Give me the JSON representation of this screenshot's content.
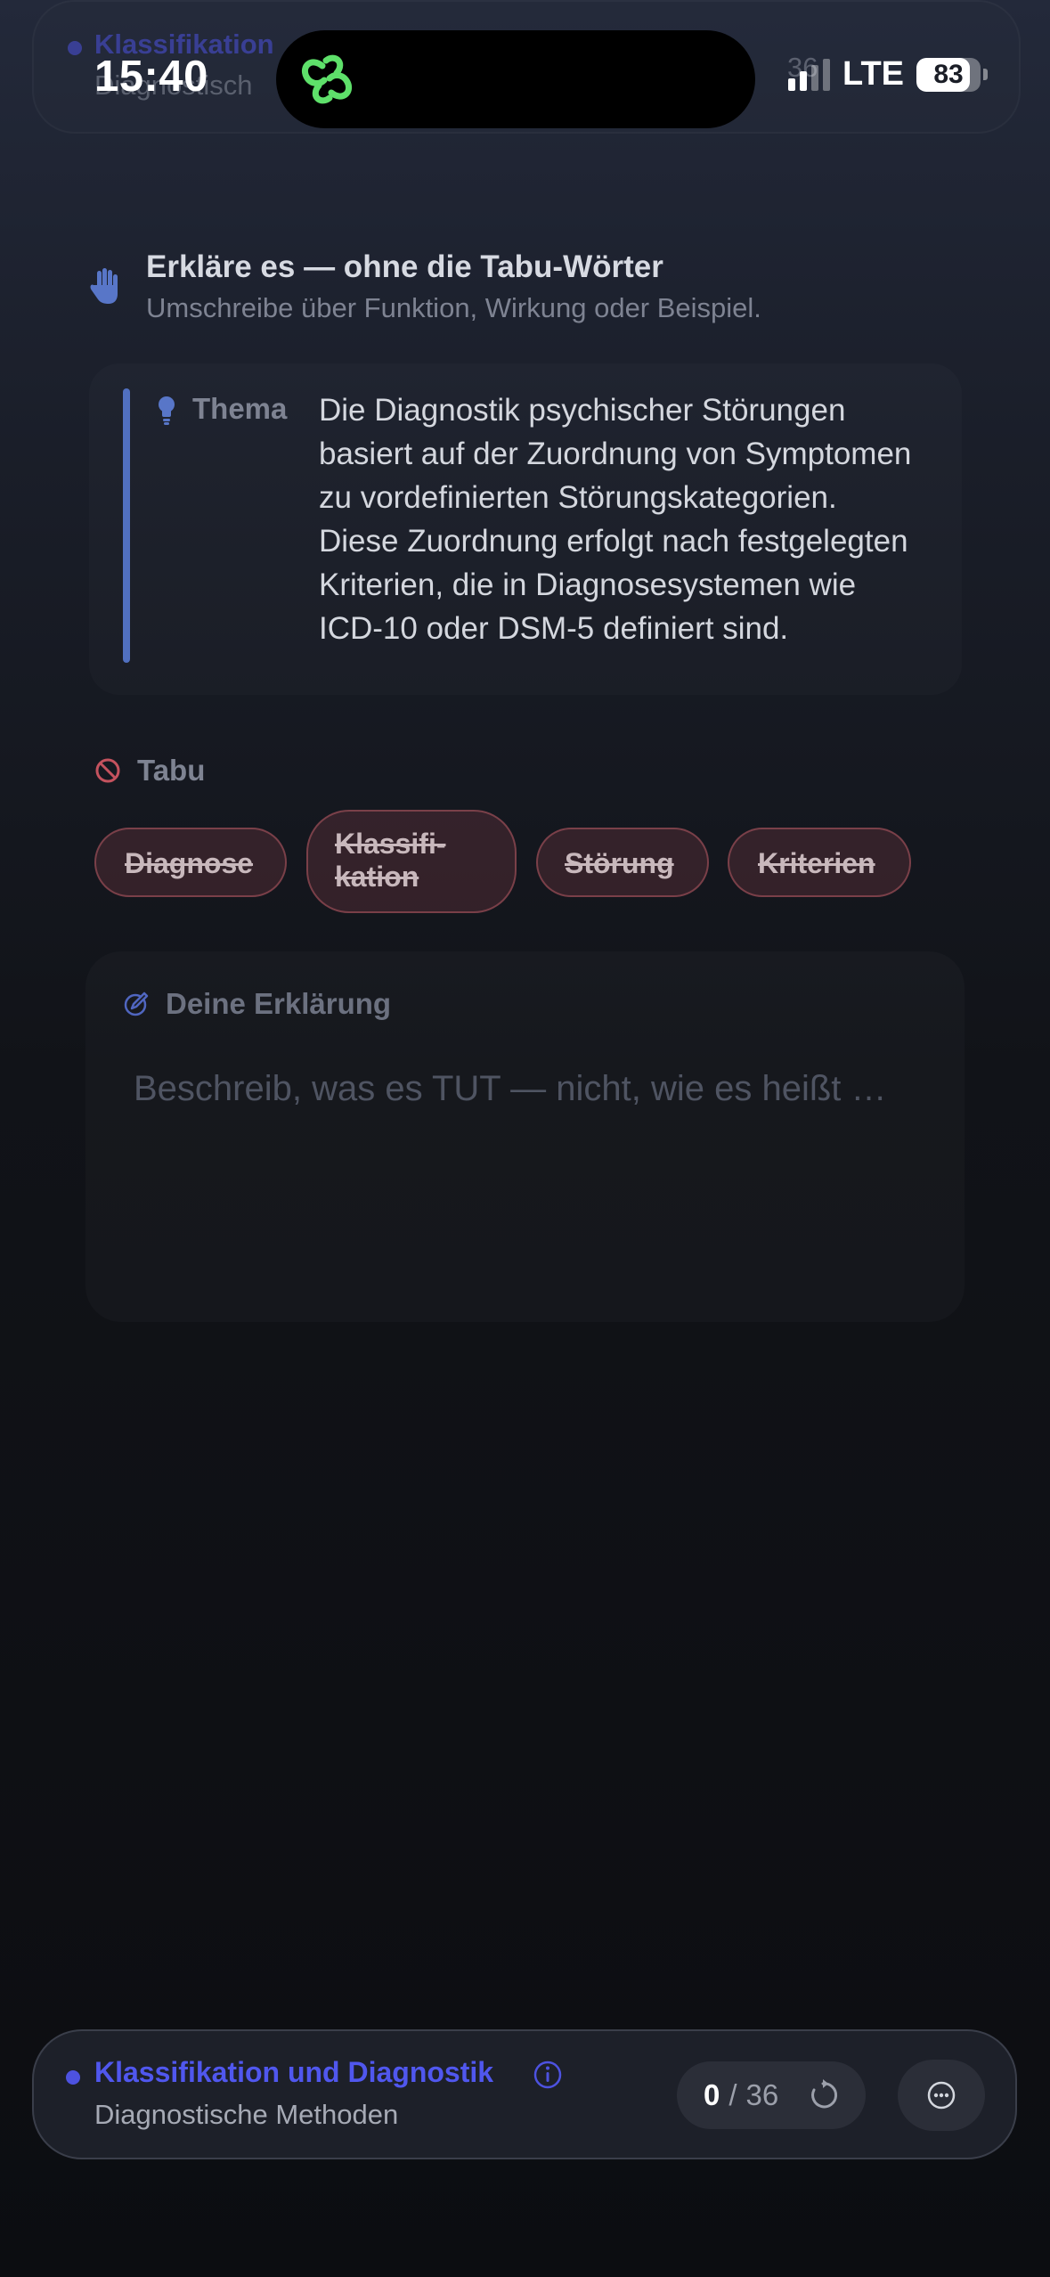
{
  "status_bar": {
    "time": "15:40",
    "network": "LTE",
    "battery": "83",
    "battery_level": 0.83
  },
  "ghost_header": {
    "title": "Klassifikation",
    "subtitle": "Diagnostisch",
    "count": "36"
  },
  "instructions": {
    "title": "Erkläre es — ohne die Tabu-Wörter",
    "subtitle": "Umschreibe über Funktion, Wirkung oder Beispiel."
  },
  "topic": {
    "label": "Thema",
    "text": "Die Diagnostik psychischer Störungen basiert auf der Zuordnung von Sym­ptomen zu vordefinierten Störungs­kategorien. Diese Zuordnung erfolgt nach festgelegten Kriterien, die in Diagnosesystemen wie ICD-10 oder DSM-5 definiert sind."
  },
  "taboo": {
    "label": "Tabu",
    "words": [
      "Diagnose",
      "Klassifi-",
      "kation",
      "Störung",
      "Kriterien"
    ]
  },
  "explanation": {
    "label": "Deine Erklärung",
    "value": "",
    "placeholder": "Beschreib, was es TUT — nicht, wie es heißt …"
  },
  "bottom_bar": {
    "title": "Klassifikation und Diagnostik",
    "subtitle": "Diagnostische Methoden",
    "count_current": "0",
    "count_separator": "/",
    "count_total": "36"
  },
  "colors": {
    "accent": "#5057ee",
    "topic_bar": "#5170c0",
    "taboo_border": "#b45a64",
    "island_icon": "#5ee06a"
  },
  "icons": {
    "instructions": "hand-icon",
    "topic": "lightbulb-icon",
    "taboo": "ban-icon",
    "explanation": "pencil-circle-icon",
    "info": "info-icon",
    "reset": "reset-icon",
    "more": "more-icon"
  }
}
